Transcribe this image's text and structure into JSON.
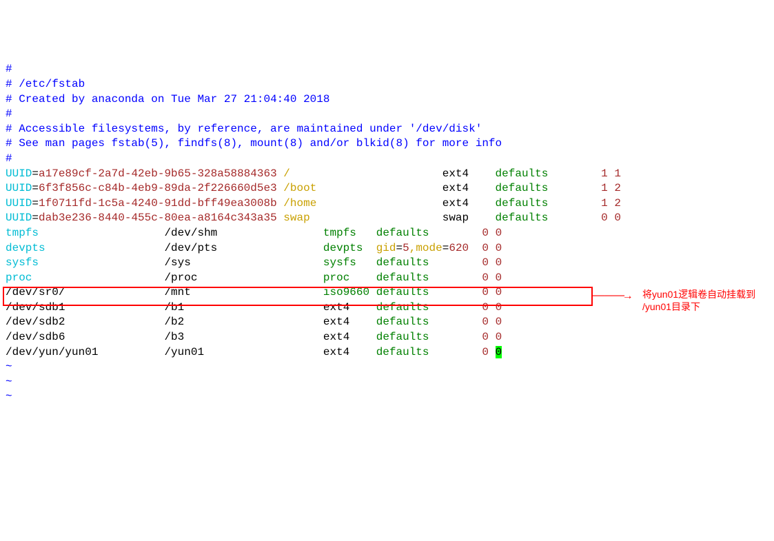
{
  "comments": {
    "c1": "#",
    "c2": "# /etc/fstab",
    "c3": "# Created by anaconda on Tue Mar 27 21:04:40 2018",
    "c4": "#",
    "c5": "# Accessible filesystems, by reference, are maintained under '/dev/disk'",
    "c6": "# See man pages fstab(5), findfs(8), mount(8) and/or blkid(8) for more info",
    "c7": "#"
  },
  "uuid_rows": [
    {
      "prefix": "UUID",
      "eq": "=",
      "uuid": "a17e89cf-2a7d-42eb-9b65-328a58884363",
      "mount": "/",
      "type": "ext4",
      "opts": "defaults",
      "dump": "1",
      "pass": "1"
    },
    {
      "prefix": "UUID",
      "eq": "=",
      "uuid": "6f3f856c-c84b-4eb9-89da-2f226660d5e3",
      "mount": "/boot",
      "type": "ext4",
      "opts": "defaults",
      "dump": "1",
      "pass": "2"
    },
    {
      "prefix": "UUID",
      "eq": "=",
      "uuid": "1f0711fd-1c5a-4240-91dd-bff49ea3008b",
      "mount": "/home",
      "type": "ext4",
      "opts": "defaults",
      "dump": "1",
      "pass": "2"
    },
    {
      "prefix": "UUID",
      "eq": "=",
      "uuid": "dab3e236-8440-455c-80ea-a8164c343a35",
      "mount": "swap",
      "type": "swap",
      "opts": "defaults",
      "dump": "0",
      "pass": "0"
    }
  ],
  "fs_rows": [
    {
      "dev": "tmpfs",
      "dev_color": "cyan",
      "mount": "/dev/shm",
      "type": "tmpfs",
      "type_color": "green",
      "opts": "defaults",
      "opts_color": "green",
      "dump": "0",
      "pass": "0"
    },
    {
      "dev": "devpts",
      "dev_color": "cyan",
      "mount": "/dev/pts",
      "type": "devpts",
      "type_color": "green",
      "opts_parts": [
        {
          "t": "gid",
          "c": "gold"
        },
        {
          "t": "=",
          "c": "black"
        },
        {
          "t": "5",
          "c": "brown"
        },
        {
          "t": ",",
          "c": "gold"
        },
        {
          "t": "mode",
          "c": "gold"
        },
        {
          "t": "=",
          "c": "black"
        },
        {
          "t": "620",
          "c": "brown"
        }
      ],
      "dump": "0",
      "pass": "0"
    },
    {
      "dev": "sysfs",
      "dev_color": "cyan",
      "mount": "/sys",
      "type": "sysfs",
      "type_color": "green",
      "opts": "defaults",
      "opts_color": "green",
      "dump": "0",
      "pass": "0"
    },
    {
      "dev": "proc",
      "dev_color": "cyan",
      "mount": "/proc",
      "type": "proc",
      "type_color": "green",
      "opts": "defaults",
      "opts_color": "green",
      "dump": "0",
      "pass": "0"
    },
    {
      "dev": "/dev/sr0/",
      "dev_color": "black",
      "mount": "/mnt",
      "type": "iso9660",
      "type_color": "green",
      "opts": "defaults",
      "opts_color": "green",
      "dump": "0",
      "pass": "0"
    },
    {
      "dev": "/dev/sdb1",
      "dev_color": "black",
      "mount": "/b1",
      "type": "ext4",
      "type_color": "black",
      "opts": "defaults",
      "opts_color": "green",
      "dump": "0",
      "pass": "0"
    },
    {
      "dev": "/dev/sdb2",
      "dev_color": "black",
      "mount": "/b2",
      "type": "ext4",
      "type_color": "black",
      "opts": "defaults",
      "opts_color": "green",
      "dump": "0",
      "pass": "0"
    },
    {
      "dev": "/dev/sdb6",
      "dev_color": "black",
      "mount": "/b3",
      "type": "ext4",
      "type_color": "black",
      "opts": "defaults",
      "opts_color": "green",
      "dump": "0",
      "pass": "0"
    }
  ],
  "highlight_row": {
    "dev": "/dev/yun/yun01",
    "mount": "/yun01",
    "type": "ext4",
    "opts": "defaults",
    "dump": "0",
    "pass": "0"
  },
  "tildes": {
    "t1": "~",
    "t2": "~",
    "t3": "~"
  },
  "annotation": {
    "arrow": "→",
    "text1": "将yun01逻辑卷自动挂载到",
    "text2": "/yun01目录下"
  }
}
